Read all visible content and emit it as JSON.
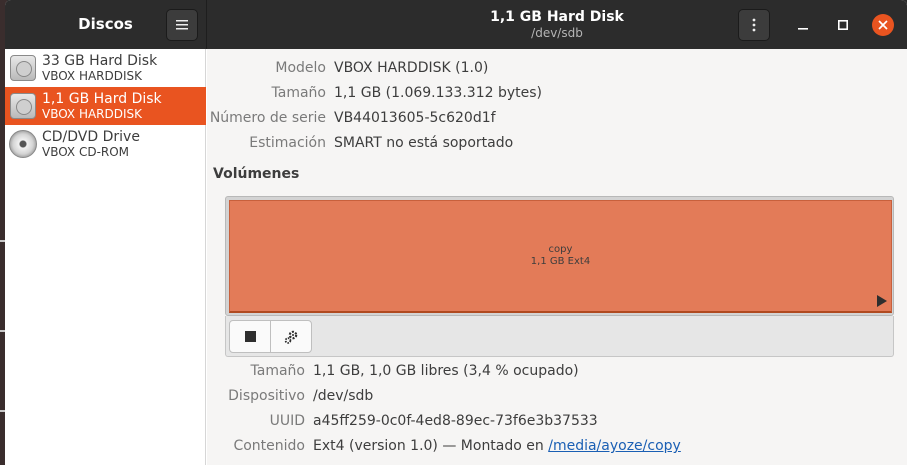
{
  "sidebar": {
    "title": "Discos",
    "drives": [
      {
        "name": "33 GB Hard Disk",
        "model": "VBOX HARDDISK",
        "icon": "hard-disk-icon",
        "selected": false
      },
      {
        "name": "1,1 GB Hard Disk",
        "model": "VBOX HARDDISK",
        "icon": "hard-disk-icon",
        "selected": true
      },
      {
        "name": "CD/DVD Drive",
        "model": "VBOX CD-ROM",
        "icon": "optical-drive-icon",
        "selected": false
      }
    ]
  },
  "header": {
    "title": "1,1 GB Hard Disk",
    "subtitle": "/dev/sdb",
    "menu_icon": "hamburger-menu-icon",
    "more_icon": "vertical-ellipsis-icon"
  },
  "drive_info": {
    "rows": [
      {
        "key": "Modelo",
        "value": "VBOX HARDDISK (1.0)"
      },
      {
        "key": "Tamaño",
        "value": "1,1 GB (1.069.133.312 bytes)"
      },
      {
        "key": "Número de serie",
        "value": "VB44013605-5c620d1f"
      },
      {
        "key": "Estimación",
        "value": "SMART no está soportado"
      }
    ]
  },
  "volumes": {
    "title": "Volúmenes",
    "partition": {
      "name": "copy",
      "detail": "1,1 GB Ext4"
    },
    "toolbar": {
      "stop_icon": "stop-icon",
      "settings_icon": "gears-icon"
    }
  },
  "volume_info": {
    "size_key": "Tamaño",
    "size_value": "1,1 GB, 1,0 GB libres (3,4 % ocupado)",
    "device_key": "Dispositivo",
    "device_value": "/dev/sdb",
    "uuid_key": "UUID",
    "uuid_value": "a45ff259-0c0f-4ed8-89ec-73f6e3b37533",
    "content_key": "Contenido",
    "content_value": "Ext4 (version 1.0) — Montado en",
    "mount_link": "/media/ayoze/copy"
  },
  "colors": {
    "accent": "#e95420",
    "partition": "#e37b58",
    "headerbar": "#2c2c2c",
    "link": "#1a5fb4"
  }
}
